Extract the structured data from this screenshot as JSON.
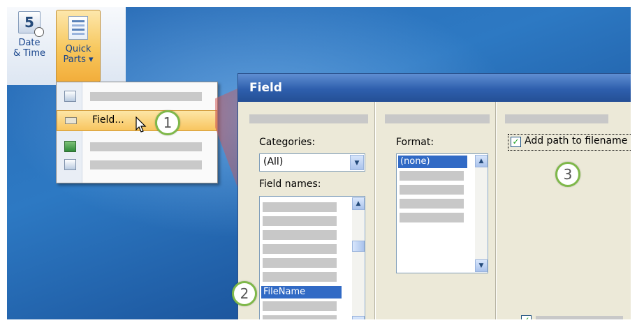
{
  "ribbon": {
    "date_time": {
      "line1": "Date",
      "line2": "& Time",
      "icon": "calendar-clock-icon",
      "day": "5"
    },
    "quick_parts": {
      "line1": "Quick",
      "line2": "Parts ▾",
      "icon": "quick-parts-icon"
    }
  },
  "menu": {
    "items": [
      {
        "icon": "document-parts-icon",
        "label": ""
      },
      {
        "icon": "field-icon",
        "label": "Field..."
      },
      {
        "icon": "building-blocks-icon",
        "label": ""
      },
      {
        "icon": "save-selection-icon",
        "label": ""
      }
    ]
  },
  "callouts": [
    "1",
    "2",
    "3"
  ],
  "dialog": {
    "title": "Field",
    "categories_label": "Categories:",
    "categories_value": "(All)",
    "field_names_label": "Field names:",
    "field_names_selected": "FileName",
    "format_label": "Format:",
    "format_selected": "(none)",
    "option_label": "Add path to filename",
    "option_checked": true,
    "bottom_checkbox_checked": true
  },
  "colors": {
    "accent_orange": "#f8c55f",
    "selection_blue": "#316ac5",
    "callout_green": "#7fb84a",
    "title_blue": "#2e5fad"
  }
}
